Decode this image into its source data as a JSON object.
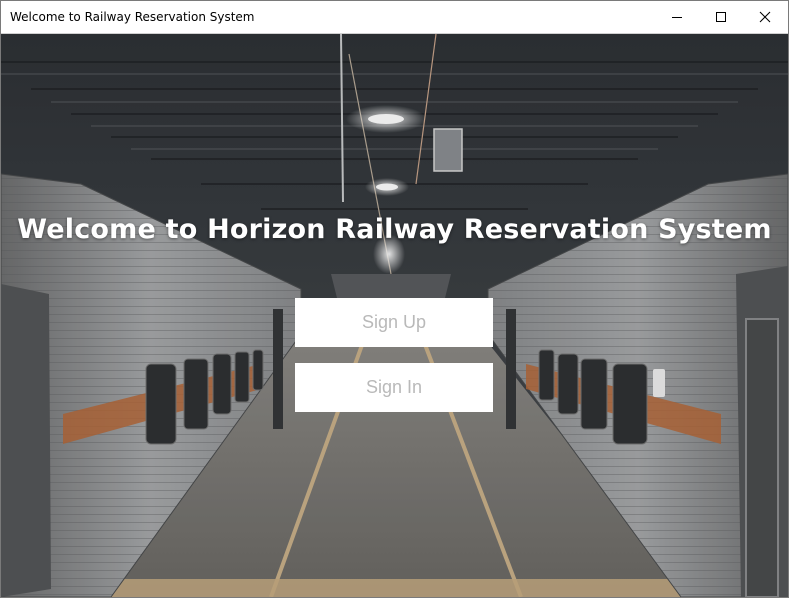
{
  "window": {
    "title": "Welcome to Railway Reservation System",
    "controls": [
      "minimize-icon",
      "maximize-icon",
      "close-icon"
    ]
  },
  "main": {
    "headline": "Welcome to Horizon Railway Reservation System",
    "buttons": {
      "sign_up": "Sign Up",
      "sign_in": "Sign In"
    },
    "background": "train-station-platform-photo"
  },
  "colors": {
    "headline_text": "#ffffff",
    "button_bg": "#ffffff",
    "button_text": "#b9b9b9",
    "titlebar_bg": "#ffffff"
  }
}
